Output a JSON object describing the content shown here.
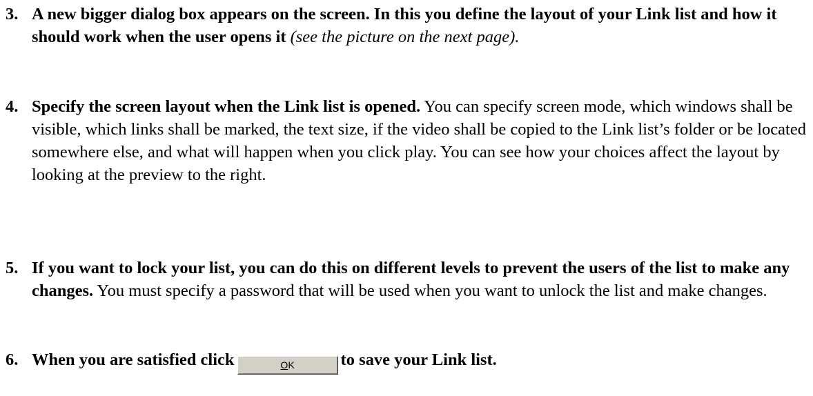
{
  "steps": [
    {
      "number": "3.",
      "bold_text": "A new bigger dialog box appears on the screen. In this you define the layout of your Link list and how it should work when the user opens it",
      "italic_text": "(see the picture on the next page)."
    },
    {
      "number": "4.",
      "bold_text": "Specify the screen layout when the Link list is opened.",
      "normal_text": "You can specify screen mode, which windows shall be visible, which links shall be marked, the text size, if the video shall be copied to the Link list’s folder or be located somewhere else, and what will happen when you click play. You can see how your choices affect the layout by looking at the preview to the right."
    },
    {
      "number": "5.",
      "bold_text": "If you want to lock your list, you can do this on different levels to prevent the users of the list to make any changes.",
      "normal_text": "You must specify a password that will be used when you want to unlock the list and make changes."
    },
    {
      "number": "6.",
      "bold_before": "When you are satisfied click",
      "button": {
        "mnemonic": "O",
        "rest": "K"
      },
      "bold_after": "to save your Link list."
    }
  ]
}
